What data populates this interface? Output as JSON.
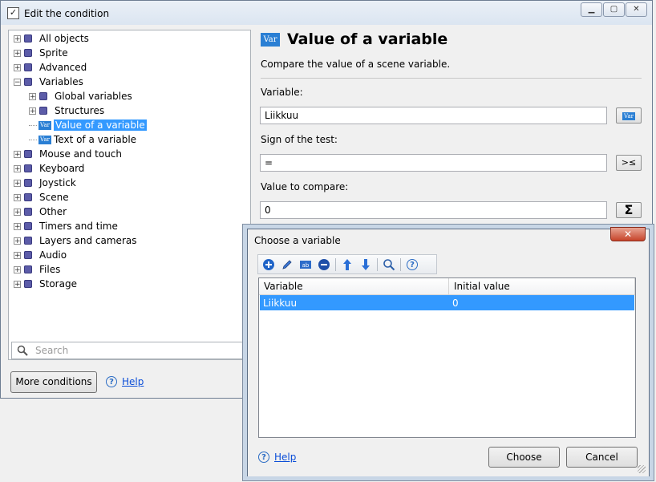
{
  "main_window": {
    "title": "Edit the condition",
    "tree": [
      {
        "label": "All objects",
        "type": "folder",
        "expander": "+"
      },
      {
        "label": "Sprite",
        "type": "folder",
        "expander": "+"
      },
      {
        "label": "Advanced",
        "type": "folder",
        "expander": "+"
      },
      {
        "label": "Variables",
        "type": "folder",
        "expander": "−"
      },
      {
        "label": "Global variables",
        "type": "folder",
        "expander": "+"
      },
      {
        "label": "Structures",
        "type": "folder",
        "expander": "+"
      },
      {
        "label": "Value of a variable",
        "type": "var",
        "selected": true
      },
      {
        "label": "Text of a variable",
        "type": "var"
      },
      {
        "label": "Mouse and touch",
        "type": "folder",
        "expander": "+"
      },
      {
        "label": "Keyboard",
        "type": "folder",
        "expander": "+"
      },
      {
        "label": "Joystick",
        "type": "folder",
        "expander": "+"
      },
      {
        "label": "Scene",
        "type": "folder",
        "expander": "+"
      },
      {
        "label": "Other",
        "type": "folder",
        "expander": "+"
      },
      {
        "label": "Timers and time",
        "type": "folder",
        "expander": "+"
      },
      {
        "label": "Layers and cameras",
        "type": "folder",
        "expander": "+"
      },
      {
        "label": "Audio",
        "type": "folder",
        "expander": "+"
      },
      {
        "label": "Files",
        "type": "folder",
        "expander": "+"
      },
      {
        "label": "Storage",
        "type": "folder",
        "expander": "+"
      }
    ],
    "search_placeholder": "Search",
    "more_conditions_label": "More conditions",
    "help_label": "Help",
    "var_icon_text": "Var"
  },
  "condition": {
    "title": "Value of a variable",
    "description": "Compare the value of a scene variable.",
    "variable_label": "Variable:",
    "variable_value": "Liikkuu",
    "sign_label": "Sign of the test:",
    "sign_value": "=",
    "compare_label": "Value to compare:",
    "compare_value": "0",
    "sign_button_glyph": ">≤",
    "sigma_button_glyph": "Σ"
  },
  "dialog": {
    "title": "Choose a variable",
    "close_glyph": "✕",
    "columns": [
      "Variable",
      "Initial value"
    ],
    "rows": [
      {
        "variable": "Liikkuu",
        "initial_value": "0",
        "selected": true
      }
    ],
    "help_label": "Help",
    "choose_label": "Choose",
    "cancel_label": "Cancel",
    "toolbar_icons": [
      "add-icon",
      "edit-icon",
      "rename-icon",
      "remove-icon",
      "move-up-icon",
      "move-down-icon",
      "search-icon",
      "help-icon"
    ]
  },
  "colors": {
    "selection": "#3399ff",
    "link": "#0b4ed8",
    "var_icon": "#2a7fd4"
  }
}
